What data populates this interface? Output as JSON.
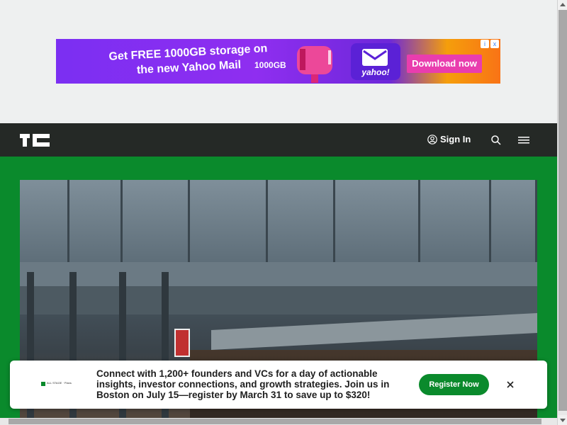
{
  "ad": {
    "headline": "Get FREE 1000GB storage on the new Yahoo Mail",
    "mailbox_label": "1000GB",
    "brand": "yahoo!",
    "cta": "Download now",
    "controls": [
      "i",
      "x"
    ],
    "colors": {
      "background": "#7b2ff2",
      "cta": "#e93dae",
      "accent": "#f59e0b"
    }
  },
  "header": {
    "logo": "TC",
    "signin_label": "Sign In",
    "icons": [
      "user-icon",
      "search-icon",
      "menu-icon"
    ],
    "colors": {
      "background": "#252926"
    }
  },
  "hero": {
    "colors": {
      "background": "#0a8a2c"
    },
    "image": "building-crowd-photo"
  },
  "promo": {
    "logo_text": "ALL STAGE · Plans",
    "message": "Connect with 1,200+ founders and VCs for a day of actionable insights, investor connections, and growth strategies. Join us in Boston on July 15—register by March 31 to save up to $320!",
    "cta": "Register Now",
    "close": "close-icon",
    "colors": {
      "cta": "#0a8a2c"
    }
  }
}
